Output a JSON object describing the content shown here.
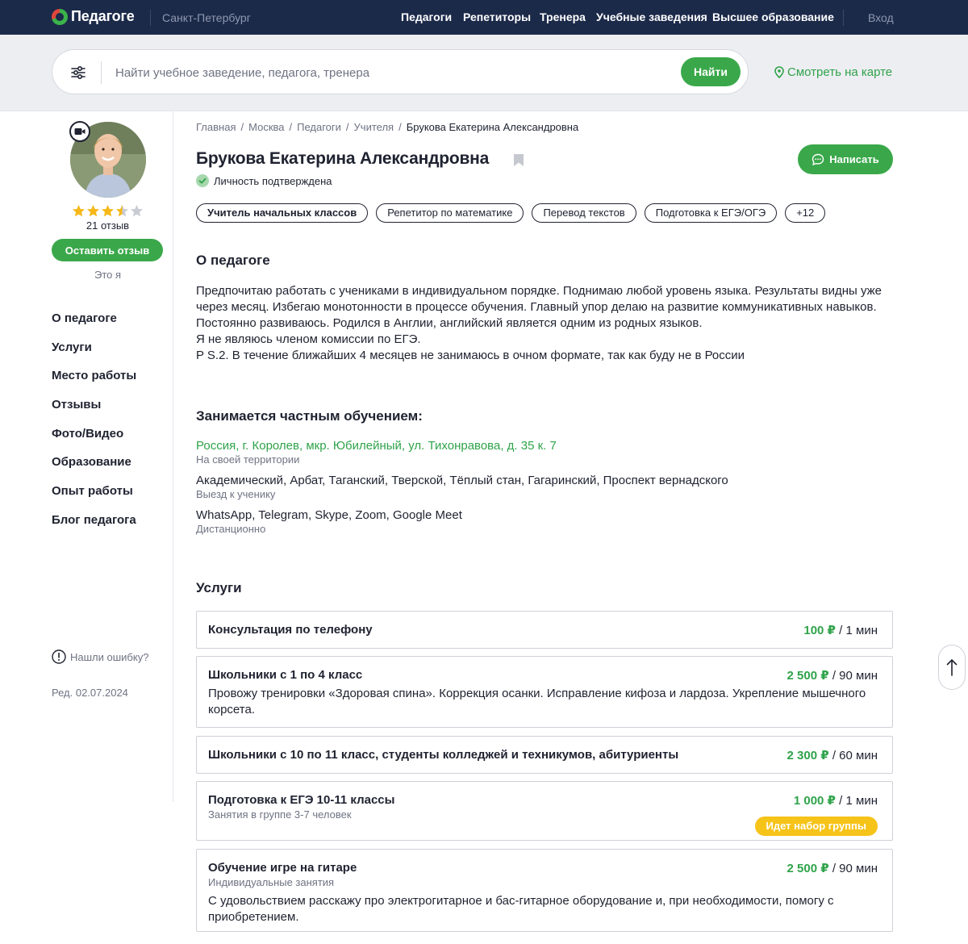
{
  "brand": {
    "name": "Педагоге",
    "city": "Санкт-Петербург"
  },
  "nav": {
    "items": [
      "Педагоги",
      "Репетиторы",
      "Тренера",
      "Учебные заведения",
      "Высшее образование"
    ],
    "login": "Вход"
  },
  "search": {
    "placeholder": "Найти учебное заведение, педагога, тренера",
    "button": "Найти",
    "map_link": "Смотреть на карте"
  },
  "profile": {
    "reviews_count": "21 отзыв",
    "rating": 3.5,
    "rating_max": 5,
    "leave_review": "Оставить отзыв",
    "its_me": "Это я"
  },
  "side_menu": [
    "О педагоге",
    "Услуги",
    "Место работы",
    "Отзывы",
    "Фото/Видео",
    "Образование",
    "Опыт работы",
    "Блог педагога"
  ],
  "report_error": "Нашли ошибку?",
  "edited": "Ред. 02.07.2024",
  "breadcrumb": [
    "Главная",
    "Москва",
    "Педагоги",
    "Учителя",
    "Брукова Екатерина Александровна"
  ],
  "teacher": {
    "name": "Брукова Екатерина Александровна",
    "verified": "Личность подтверждена",
    "write_button": "Написать",
    "tags": [
      "Учитель начальных классов",
      "Репетитор по математике",
      "Перевод текстов",
      "Подготовка к ЕГЭ/ОГЭ",
      "+12"
    ]
  },
  "about": {
    "title": "О педагоге",
    "lines": [
      "Предпочитаю работать с учениками в индивидуальном порядке. Поднимаю любой уровень языка. Результаты видны уже через месяц. Избегаю монотонности в процессе обучения. Главный упор делаю на развитие коммуникативных навыков. Постоянно развиваюсь. Родился в Англии, английский является одним из родных языков.",
      "Я не являюсь членом комиссии по ЕГЭ.",
      "P S.2. В течение ближайших 4 месяцев не занимаюсь в очном формате, так как буду не в России"
    ]
  },
  "private": {
    "title": "Занимается частным обучением:",
    "address": "Россия, г. Королев, мкр. Юбилейный, ул. Тихонравова, д. 35 к. 7",
    "address_note": "На своей территории",
    "districts": "Академический, Арбат, Таганский, Тверской, Тёплый стан, Гагаринский, Проспект вернадского",
    "districts_note": "Выезд к ученику",
    "online": "WhatsApp, Telegram, Skype, Zoom, Google Meet",
    "online_note": "Дистанционно"
  },
  "services": {
    "title": "Услуги",
    "items": [
      {
        "title": "Консультация по телефону",
        "price": "100 ₽",
        "unit": " / 1 мин"
      },
      {
        "title": "Школьники с 1 по 4 класс",
        "price": "2 500 ₽",
        "unit": " / 90 мин",
        "desc": "Провожу тренировки «Здоровая спина». Коррекция осанки. Исправление кифоза и лардоза. Укрепление мышечного корсета."
      },
      {
        "title": "Школьники с 10 по 11 класс, студенты колледжей и техникумов, абитуриенты",
        "price": "2 300 ₽",
        "unit": " / 60 мин"
      },
      {
        "title": "Подготовка к ЕГЭ 10-11 классы",
        "price": "1 000 ₽",
        "unit": " / 1 мин",
        "sub": "Занятия в группе 3-7 человек",
        "badge": "Идет набор группы"
      },
      {
        "title": "Обучение игре на гитаре",
        "price": "2 500 ₽",
        "unit": " / 90 мин",
        "sub": "Индивидуальные занятия",
        "desc": "С удовольствием расскажу про электрогитарное и бас-гитарное оборудование и, при необходимости, помогу с приобретением."
      }
    ]
  },
  "colors": {
    "nav_bg": "#1c2a4a",
    "accent": "#3aa84a",
    "badge": "#f6c319"
  }
}
